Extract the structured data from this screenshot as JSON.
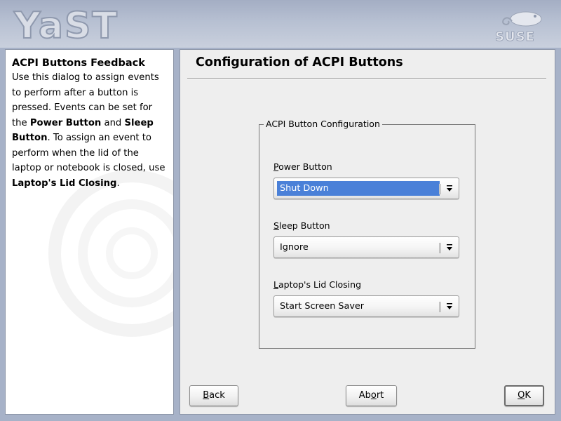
{
  "header": {
    "logo_text": "YaST",
    "brand_logo_text": "SUSE"
  },
  "help": {
    "title": "ACPI Buttons Feedback",
    "text_1": "Use this dialog to assign events to perform after a button is pressed. Events can be set for the ",
    "power_button": "Power Button",
    "text_and": " and ",
    "sleep_button": "Sleep Button",
    "text_2": ". To assign an event to perform when the lid of the laptop or notebook is closed, use ",
    "lid_closing": "Laptop's Lid Closing",
    "text_end": "."
  },
  "main": {
    "title": "Configuration of ACPI Buttons",
    "group_label": "ACPI Button Configuration",
    "fields": [
      {
        "label_key": "P",
        "label_rest": "ower Button",
        "value": "Shut Down"
      },
      {
        "label_key": "S",
        "label_rest": "leep Button",
        "value": "Ignore"
      },
      {
        "label_key": "L",
        "label_rest": "aptop's Lid Closing",
        "value": "Start Screen Saver"
      }
    ]
  },
  "buttons": {
    "back_key": "B",
    "back_rest": "ack",
    "abort_pre": "Ab",
    "abort_key": "o",
    "abort_post": "rt",
    "ok_key": "O",
    "ok_rest": "K"
  },
  "colors": {
    "selection": "#4a80d8",
    "header_bg": "#a4aec4",
    "panel_bg": "#eeeeee"
  },
  "icons": {
    "combo_arrow": "down-arrow-icon",
    "brand": "suse-chameleon-icon"
  }
}
